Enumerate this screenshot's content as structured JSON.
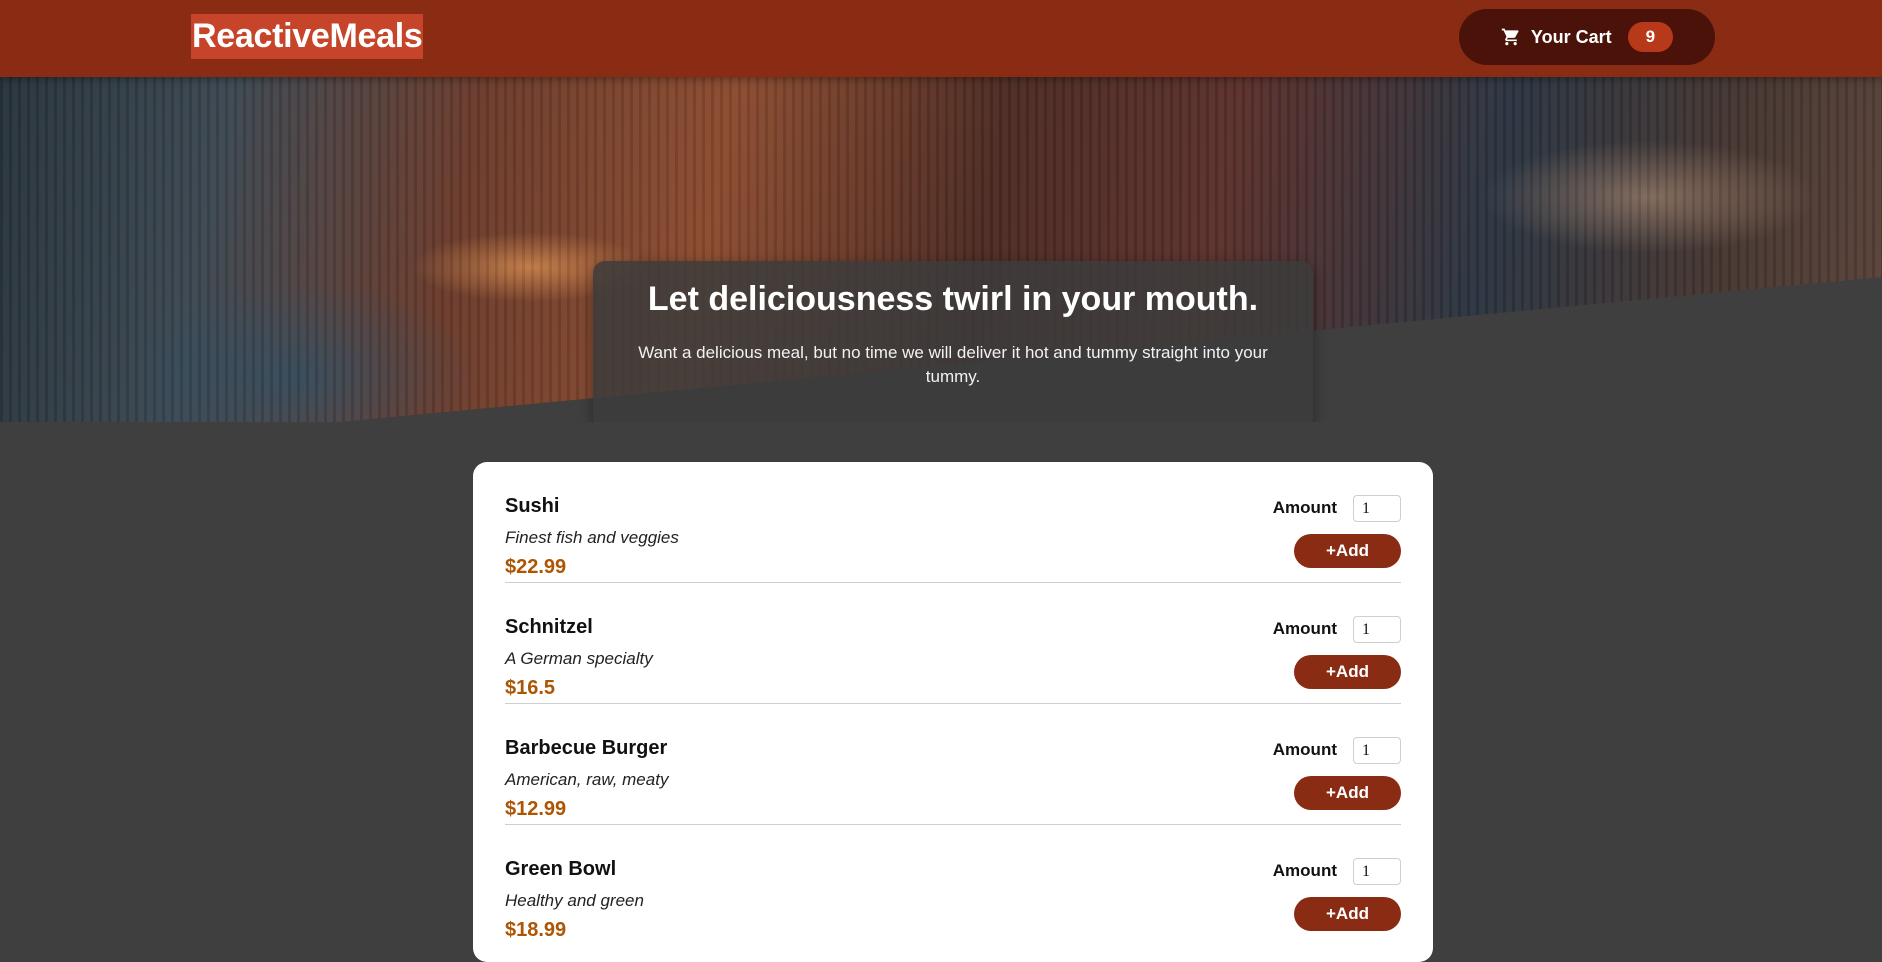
{
  "header": {
    "logo": "ReactiveMeals",
    "cart": {
      "label": "Your Cart",
      "count": "9",
      "icon": "cart-icon"
    }
  },
  "hero": {
    "title": "Let deliciousness twirl in your mouth.",
    "text": "Want a delicious meal, but no time we will deliver it hot and tummy straight into your tummy."
  },
  "meals": [
    {
      "name": "Sushi",
      "description": "Finest fish and veggies",
      "price": "$22.99",
      "amount_label": "Amount",
      "amount_value": "1",
      "add_label": "+Add"
    },
    {
      "name": "Schnitzel",
      "description": "A German specialty",
      "price": "$16.5",
      "amount_label": "Amount",
      "amount_value": "1",
      "add_label": "+Add"
    },
    {
      "name": "Barbecue Burger",
      "description": "American, raw, meaty",
      "price": "$12.99",
      "amount_label": "Amount",
      "amount_value": "1",
      "add_label": "+Add"
    },
    {
      "name": "Green Bowl",
      "description": "Healthy and green",
      "price": "$18.99",
      "amount_label": "Amount",
      "amount_value": "1",
      "add_label": "+Add"
    }
  ],
  "colors": {
    "header": "#8a2b14",
    "logo_bg": "#c6452a",
    "cart_button": "#4a1208",
    "cart_badge": "#b8381a",
    "page_bg": "#3f3f3f",
    "price": "#ad5502",
    "add_button": "#8a2b14"
  }
}
